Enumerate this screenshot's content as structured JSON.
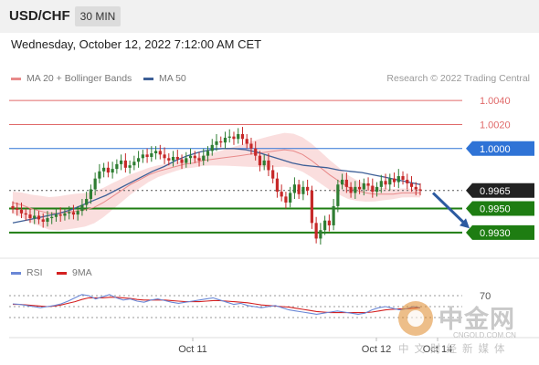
{
  "header": {
    "symbol": "USD/CHF",
    "interval": "30 MIN"
  },
  "datetime": "Wednesday, October 12, 2022 7:12:00 AM CET",
  "legend": {
    "ma20": {
      "label": "MA 20 + Bollinger Bands",
      "color": "#e88a8a"
    },
    "ma50": {
      "label": "MA 50",
      "color": "#3d5f97"
    }
  },
  "credit": "Research © 2022 Trading Central",
  "rsi_legend": {
    "rsi": {
      "label": "RSI",
      "color": "#6a87d6"
    },
    "ma9": {
      "label": "9MA",
      "color": "#d42020"
    }
  },
  "watermark": {
    "name": "中金网",
    "url": "CNGOLD.COM.CN",
    "subtitle": "中文财经新媒体"
  },
  "chart_data": {
    "type": "candlestick",
    "x_tick_labels": [
      "Oct 11",
      "Oct 12",
      "Oct 14"
    ],
    "ylim": [
      0.992,
      1.005
    ],
    "price_levels": [
      {
        "label": "1.0040",
        "value": 1.004,
        "kind": "resistance",
        "color": "#e06a6a"
      },
      {
        "label": "1.0020",
        "value": 1.002,
        "kind": "resistance",
        "color": "#e06a6a"
      },
      {
        "label": "1.0000",
        "value": 1.0,
        "kind": "pivot",
        "color": "#2f73d6"
      },
      {
        "label": "0.9965",
        "value": 0.9965,
        "kind": "last",
        "color": "#222222"
      },
      {
        "label": "0.9950",
        "value": 0.995,
        "kind": "target",
        "color": "#1e7d12"
      },
      {
        "label": "0.9930",
        "value": 0.993,
        "kind": "target",
        "color": "#1e7d12"
      }
    ],
    "candles_close": [
      0.995,
      0.9949,
      0.9946,
      0.9945,
      0.9942,
      0.9944,
      0.9941,
      0.9939,
      0.9942,
      0.9943,
      0.9945,
      0.9944,
      0.9946,
      0.9947,
      0.9945,
      0.9948,
      0.9953,
      0.9958,
      0.9966,
      0.9975,
      0.9981,
      0.9984,
      0.998,
      0.9983,
      0.9987,
      0.999,
      0.9984,
      0.9986,
      0.9989,
      0.9992,
      0.9995,
      0.9993,
      0.9996,
      0.9998,
      0.9995,
      0.9992,
      0.999,
      0.9993,
      0.9991,
      0.9988,
      0.9992,
      0.9994,
      0.9992,
      0.999,
      0.9994,
      0.9998,
      1.0003,
      1.0006,
      1.0005,
      1.0009,
      1.001,
      1.0008,
      1.0012,
      1.0008,
      1.0004,
      1.0,
      0.9994,
      0.9986,
      0.999,
      0.9982,
      0.9975,
      0.9964,
      0.996,
      0.9955,
      0.9963,
      0.997,
      0.9962,
      0.9968,
      0.9965,
      0.9938,
      0.9925,
      0.9932,
      0.994,
      0.9936,
      0.9952,
      0.997,
      0.9974,
      0.9968,
      0.9963,
      0.9968,
      0.9966,
      0.9971,
      0.9969,
      0.9964,
      0.9968,
      0.9973,
      0.997,
      0.9975,
      0.9972,
      0.9977,
      0.9974,
      0.9971,
      0.9968,
      0.9966,
      0.9965
    ],
    "ma20": [
      0.9955,
      0.9953,
      0.995,
      0.9948,
      0.9946,
      0.9946,
      0.9947,
      0.9948,
      0.9949,
      0.9951,
      0.9955,
      0.996,
      0.9965,
      0.997,
      0.9974,
      0.9978,
      0.9981,
      0.9983,
      0.9985,
      0.9987,
      0.9988,
      0.999,
      0.9991,
      0.9992,
      0.9993,
      0.9994,
      0.9995,
      0.9996,
      0.9997,
      0.9998,
      0.9999,
      0.9998,
      0.9995,
      0.999,
      0.9984,
      0.9978,
      0.9973,
      0.9968,
      0.9965,
      0.9963,
      0.9962,
      0.9962,
      0.9962,
      0.9963,
      0.9963,
      0.9963
    ],
    "ma50": [
      0.9938,
      0.994,
      0.9942,
      0.9944,
      0.9946,
      0.9949,
      0.9953,
      0.9957,
      0.9961,
      0.9966,
      0.9971,
      0.9976,
      0.9981,
      0.9985,
      0.999,
      0.9994,
      0.9997,
      0.9999,
      1.0,
      1.0,
      0.9999,
      0.9997,
      0.9994,
      0.9991,
      0.9988,
      0.9986,
      0.9985,
      0.9984,
      0.9982,
      0.9981,
      0.998,
      0.9978,
      0.9976,
      0.9974,
      0.9972,
      0.997
    ],
    "rsi": {
      "level_labels": [
        "70"
      ],
      "ylim": [
        0,
        100
      ],
      "rsi_values": [
        55,
        54,
        52,
        50,
        48,
        50,
        52,
        55,
        60,
        66,
        72,
        70,
        64,
        68,
        72,
        66,
        62,
        64,
        60,
        58,
        62,
        64,
        61,
        58,
        56,
        58,
        60,
        62,
        64,
        66,
        62,
        58,
        54,
        56,
        52,
        50,
        48,
        50,
        52,
        48,
        44,
        42,
        40,
        38,
        36,
        38,
        40,
        42,
        40,
        38,
        36,
        38,
        44,
        48,
        50,
        47,
        44,
        46,
        50,
        48
      ],
      "ma9_values": [
        54,
        54,
        53,
        52,
        51,
        50,
        51,
        53,
        56,
        59,
        63,
        66,
        66,
        66,
        67,
        67,
        66,
        65,
        63,
        62,
        62,
        62,
        62,
        61,
        60,
        59,
        59,
        59,
        60,
        61,
        61,
        60,
        59,
        58,
        57,
        55,
        53,
        52,
        51,
        50,
        49,
        47,
        45,
        43,
        41,
        40,
        39,
        39,
        39,
        39,
        39,
        39,
        40,
        42,
        44,
        45,
        46,
        46,
        47,
        48
      ]
    }
  }
}
